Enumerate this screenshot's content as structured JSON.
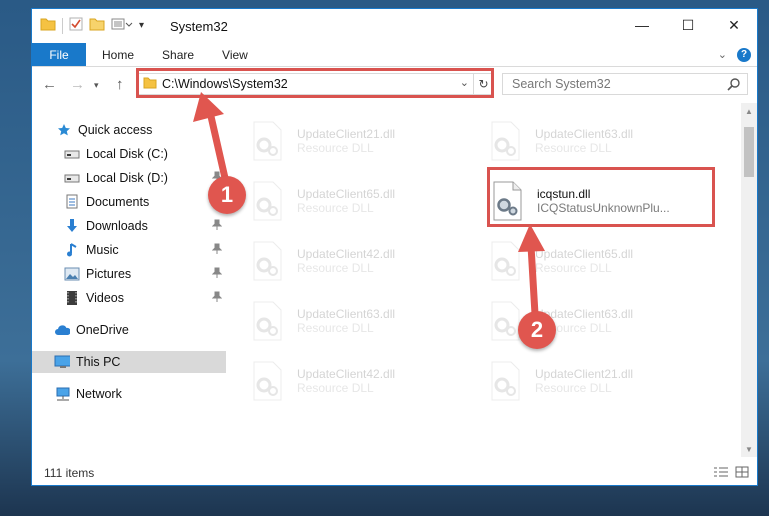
{
  "window": {
    "title": "System32",
    "minimize_glyph": "—",
    "maximize_glyph": "☐",
    "close_glyph": "✕"
  },
  "ribbon": {
    "tabs": [
      "File",
      "Home",
      "Share",
      "View"
    ],
    "help_label": "?"
  },
  "navigation": {
    "address": "C:\\Windows\\System32",
    "search_placeholder": "Search System32"
  },
  "sidebar": {
    "items": [
      {
        "label": "Quick access",
        "icon": "star-icon"
      },
      {
        "label": "Local Disk (C:)",
        "icon": "drive-icon"
      },
      {
        "label": "Local Disk (D:)",
        "icon": "drive-icon",
        "pinned": true
      },
      {
        "label": "Documents",
        "icon": "documents-icon",
        "pinned": true
      },
      {
        "label": "Downloads",
        "icon": "downloads-icon",
        "pinned": true
      },
      {
        "label": "Music",
        "icon": "music-icon",
        "pinned": true
      },
      {
        "label": "Pictures",
        "icon": "pictures-icon",
        "pinned": true
      },
      {
        "label": "Videos",
        "icon": "videos-icon",
        "pinned": true
      },
      {
        "label": "OneDrive",
        "icon": "onedrive-icon"
      },
      {
        "label": "This PC",
        "icon": "pc-icon",
        "selected": true
      },
      {
        "label": "Network",
        "icon": "network-icon"
      }
    ]
  },
  "files": [
    {
      "name": "UpdateClient21.dll",
      "type": "Resource DLL",
      "faded": true
    },
    {
      "name": "UpdateClient63.dll",
      "type": "Resource DLL",
      "faded": true
    },
    {
      "name": "UpdateClient65.dll",
      "type": "Resource DLL",
      "faded": true
    },
    {
      "name": "icqstun.dll",
      "type": "ICQStatusUnknownPlu...",
      "faded": false
    },
    {
      "name": "UpdateClient42.dll",
      "type": "Resource DLL",
      "faded": true
    },
    {
      "name": "UpdateClient65.dll",
      "type": "Resource DLL",
      "faded": true
    },
    {
      "name": "UpdateClient63.dll",
      "type": "Resource DLL",
      "faded": true
    },
    {
      "name": "UpdateClient63.dll",
      "type": "Resource DLL",
      "faded": true
    },
    {
      "name": "UpdateClient42.dll",
      "type": "Resource DLL",
      "faded": true
    },
    {
      "name": "UpdateClient21.dll",
      "type": "Resource DLL",
      "faded": true
    }
  ],
  "status": {
    "item_count": "111 items"
  },
  "annotations": [
    {
      "label": "1"
    },
    {
      "label": "2"
    }
  ],
  "colors": {
    "accent": "#1979ca",
    "annotation": "#e0564f",
    "selection": "#d9d9d9"
  }
}
